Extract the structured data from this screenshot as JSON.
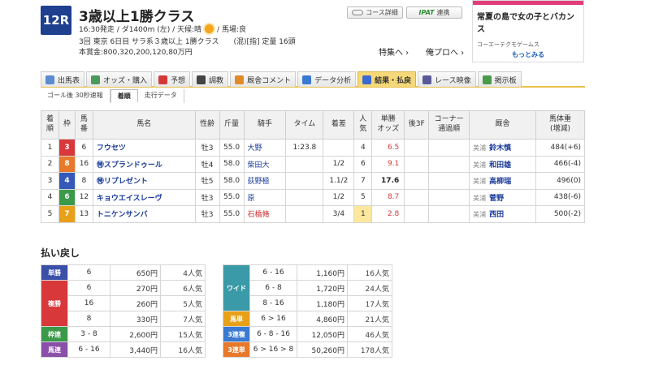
{
  "race": {
    "number": "12R",
    "title": "3歳以上1勝クラス",
    "meta_before_weather": "16:30発走 / ダ1400m (左) / 天候:晴",
    "meta_after_weather": "/ 馬場:良",
    "meta2": "3回 東京 6日目 サラ系３歳以上 1勝クラス　　(混)[指] 定量 16頭",
    "meta3": "本賞金:800,320,200,120,80万円"
  },
  "buttons": {
    "course": "コース詳細",
    "ipat_logo": "IPAT",
    "ipat": "連携"
  },
  "links": {
    "tokushu": "特集へ ›",
    "yoso": "俺プロへ ›"
  },
  "ad": {
    "title": "常夏の島で女の子とバカンス",
    "company": "コーエーテクモゲームス",
    "more": "もっとみる"
  },
  "tabs": [
    {
      "label": "出馬表",
      "color": "#5b8bd0"
    },
    {
      "label": "オッズ・購入",
      "color": "#4a9a5a"
    },
    {
      "label": "予想",
      "color": "#d23a3a"
    },
    {
      "label": "調教",
      "color": "#444444"
    },
    {
      "label": "厩舎コメント",
      "color": "#e08a2a"
    },
    {
      "label": "データ分析",
      "color": "#3a7ad0"
    },
    {
      "label": "結果・払戻",
      "color": "#3a6ad0"
    },
    {
      "label": "レース映像",
      "color": "#5a5a9a"
    },
    {
      "label": "掲示板",
      "color": "#4a9a4a"
    }
  ],
  "subtabs": [
    "ゴール後 30秒速報",
    "着順",
    "走行データ"
  ],
  "columns": [
    "着\n順",
    "枠",
    "馬\n番",
    "馬名",
    "性齢",
    "斤量",
    "騎手",
    "タイム",
    "着差",
    "人\n気",
    "単勝\nオッズ",
    "後3F",
    "コーナー\n通過順",
    "厩舎",
    "馬体重\n(増減)"
  ],
  "rows": [
    {
      "rank": "1",
      "waku": "3",
      "waku_color": "#d8383a",
      "num": "6",
      "name": "フウセツ",
      "sex": "牡3",
      "kin": "55.0",
      "jockey": "大野",
      "jockey_red": false,
      "time": "1:23.8",
      "diff": "",
      "pop": "4",
      "odds": "6.5",
      "odds_black": false,
      "region": "美浦",
      "trainer": "鈴木慎",
      "weight": "484(+6)"
    },
    {
      "rank": "2",
      "waku": "8",
      "waku_color": "#e8792b",
      "num": "16",
      "name": "㊕スプランドゥール",
      "sex": "牡4",
      "kin": "58.0",
      "jockey": "柴田大",
      "jockey_red": false,
      "time": "",
      "diff": "1/2",
      "pop": "6",
      "odds": "9.1",
      "odds_black": false,
      "region": "美浦",
      "trainer": "和田雄",
      "weight": "466(-4)"
    },
    {
      "rank": "3",
      "waku": "4",
      "waku_color": "#3559b8",
      "num": "8",
      "name": "㊕リプレゼント",
      "sex": "牡5",
      "kin": "58.0",
      "jockey": "荻野極",
      "jockey_red": false,
      "time": "",
      "diff": "1.1/2",
      "pop": "7",
      "odds": "17.6",
      "odds_black": true,
      "region": "美浦",
      "trainer": "高柳瑞",
      "weight": "496(0)"
    },
    {
      "rank": "4",
      "waku": "6",
      "waku_color": "#3a9a4a",
      "num": "12",
      "name": "キョウエイスレーヴ",
      "sex": "牡3",
      "kin": "55.0",
      "jockey": "原",
      "jockey_red": false,
      "time": "",
      "diff": "1/2",
      "pop": "5",
      "odds": "8.7",
      "odds_black": false,
      "region": "美浦",
      "trainer": "菅野",
      "weight": "438(-6)"
    },
    {
      "rank": "5",
      "waku": "7",
      "waku_color": "#e8a018",
      "num": "13",
      "name": "トニケンサンバ",
      "sex": "牡3",
      "kin": "55.0",
      "jockey": "石橋脩",
      "jockey_red": true,
      "time": "",
      "diff": "3/4",
      "pop": "1",
      "odds": "2.8",
      "odds_black": false,
      "region": "美浦",
      "trainer": "西田",
      "weight": "500(-2)"
    }
  ],
  "payback": {
    "title": "払い戻し",
    "left": [
      {
        "label": "単勝",
        "color": "#3a4fa8",
        "entries": [
          {
            "nums": "6",
            "amount": "650円",
            "pop": "4人気"
          }
        ]
      },
      {
        "label": "複勝",
        "color": "#d8383a",
        "entries": [
          {
            "nums": "6",
            "amount": "270円",
            "pop": "6人気"
          },
          {
            "nums": "16",
            "amount": "260円",
            "pop": "5人気"
          },
          {
            "nums": "8",
            "amount": "330円",
            "pop": "7人気"
          }
        ]
      },
      {
        "label": "枠連",
        "color": "#3a9a4a",
        "entries": [
          {
            "nums": "3 - 8",
            "amount": "2,600円",
            "pop": "15人気"
          }
        ]
      },
      {
        "label": "馬連",
        "color": "#8a4fa8",
        "entries": [
          {
            "nums": "6 - 16",
            "amount": "3,440円",
            "pop": "16人気"
          }
        ]
      }
    ],
    "right": [
      {
        "label": "ワイド",
        "color": "#3a9aa8",
        "entries": [
          {
            "nums": "6 - 16",
            "amount": "1,160円",
            "pop": "16人気"
          },
          {
            "nums": "6 - 8",
            "amount": "1,720円",
            "pop": "24人気"
          },
          {
            "nums": "8 - 16",
            "amount": "1,180円",
            "pop": "17人気"
          }
        ]
      },
      {
        "label": "馬単",
        "color": "#e8a018",
        "entries": [
          {
            "nums": "6 > 16",
            "amount": "4,860円",
            "pop": "21人気"
          }
        ]
      },
      {
        "label": "3連複",
        "color": "#3a7ad0",
        "entries": [
          {
            "nums": "6 - 8 - 16",
            "amount": "12,050円",
            "pop": "46人気"
          }
        ]
      },
      {
        "label": "3連単",
        "color": "#e8792b",
        "entries": [
          {
            "nums": "6 > 16 > 8",
            "amount": "50,260円",
            "pop": "178人気"
          }
        ]
      }
    ]
  }
}
